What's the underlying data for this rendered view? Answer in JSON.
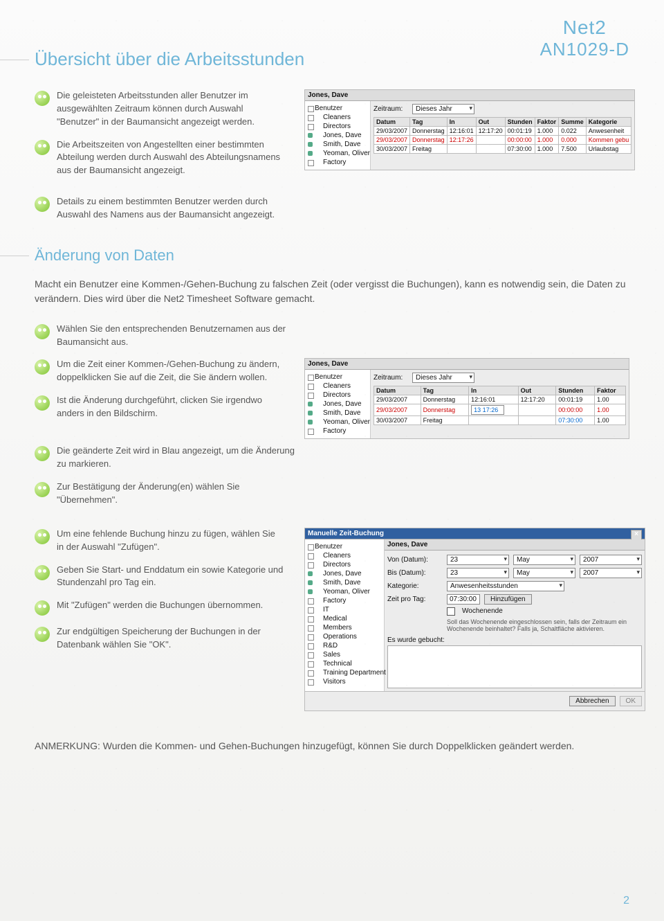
{
  "brand": {
    "line1": "Net2",
    "line2": "AN1029-D"
  },
  "page_title": "Übersicht über die Arbeitsstunden",
  "page_number": "2",
  "section1_bullets": [
    "Die geleisteten Arbeitsstunden aller Benutzer im ausgewählten Zeitraum können durch Auswahl \"Benutzer\" in der Baumansicht angezeigt werden.",
    "Die Arbeitszeiten von Angestellten einer bestimmten Abteilung werden durch Auswahl des Abteilungsnamens aus der Baumansicht angezeigt.",
    "Details zu einem bestimmten Benutzer werden durch Auswahl des Namens aus der Baumansicht angezeigt."
  ],
  "fig1": {
    "title": "Jones, Dave",
    "tree_root": "Benutzer",
    "tree_groups": [
      "Cleaners",
      "Directors"
    ],
    "tree_leaves": [
      "Jones, Dave",
      "Smith, Dave",
      "Yeoman, Oliver"
    ],
    "tree_last": "Factory",
    "period_label": "Zeitraum:",
    "period_value": "Dieses Jahr",
    "headers": [
      "Datum",
      "Tag",
      "In",
      "Out",
      "Stunden",
      "Faktor",
      "Summe",
      "Kategorie"
    ],
    "rows": [
      [
        "29/03/2007",
        "Donnerstag",
        "12:16:01",
        "12:17:20",
        "00:01:19",
        "1.000",
        "0.022",
        "Anwesenheit"
      ],
      [
        "29/03/2007",
        "Donnerstag",
        "12:17:26",
        "",
        "00:00:00",
        "1.000",
        "0.000",
        "Kommen gebu"
      ],
      [
        "30/03/2007",
        "Freitag",
        "",
        "",
        "07:30:00",
        "1.000",
        "7.500",
        "Urlaubstag"
      ]
    ]
  },
  "section2_title": "Änderung von Daten",
  "section2_intro": "Macht ein Benutzer eine Kommen-/Gehen-Buchung zu falschen Zeit (oder vergisst die Buchungen), kann es notwendig sein, die Daten zu verändern. Dies wird über die Net2 Timesheet Software gemacht.",
  "section2_bullets_a": [
    "Wählen Sie den entsprechenden Benutzernamen aus der Baumansicht aus."
  ],
  "section2_bullets_b": [
    "Um die Zeit einer Kommen-/Gehen-Buchung zu ändern, doppelklicken Sie auf die Zeit, die Sie ändern wollen.",
    "Ist die Änderung durchgeführt, clicken Sie irgendwo anders in den Bildschirm.",
    "Die geänderte Zeit wird in Blau angezeigt, um die Änderung zu markieren.",
    "Zur Bestätigung der Änderung(en) wählen Sie \"Übernehmen\"."
  ],
  "fig2": {
    "title": "Jones, Dave",
    "period_label": "Zeitraum:",
    "period_value": "Dieses Jahr",
    "headers": [
      "Datum",
      "Tag",
      "In",
      "Out",
      "Stunden",
      "Faktor"
    ],
    "rows": [
      [
        "29/03/2007",
        "Donnerstag",
        "12:16:01",
        "12:17:20",
        "00:01:19",
        "1.00"
      ],
      [
        "29/03/2007",
        "Donnerstag",
        "13 17:26",
        "",
        "00:00:00",
        "1.00"
      ],
      [
        "30/03/2007",
        "Freitag",
        "",
        "",
        "07:30:00",
        "1.00"
      ]
    ],
    "edit_cell": "13 17:26"
  },
  "section2_bullets_c": [
    "Um eine fehlende Buchung hinzu zu fügen, wählen Sie in der Auswahl \"Zufügen\".",
    "Geben Sie Start- und Enddatum ein sowie Kategorie und Stundenzahl pro Tag ein.",
    "Mit \"Zufügen\" werden die Buchungen übernommen.",
    "Zur endgültigen Speicherung der Buchungen in der Datenbank wählen Sie \"OK\"."
  ],
  "fig3": {
    "dialog_title": "Manuelle Zeit-Buchung",
    "user_title": "Jones, Dave",
    "tree_root": "Benutzer",
    "tree_groups": [
      "Cleaners",
      "Directors"
    ],
    "tree_leaves": [
      "Jones, Dave",
      "Smith, Dave",
      "Yeoman, Oliver"
    ],
    "tree_more": [
      "Factory",
      "IT",
      "Medical",
      "Members",
      "Operations",
      "R&D",
      "Sales",
      "Technical",
      "Training Department",
      "Visitors"
    ],
    "labels": {
      "from": "Von (Datum):",
      "to": "Bis (Datum):",
      "category": "Kategorie:",
      "time_per_day": "Zeit pro Tag:",
      "weekend": "Wochenende",
      "weekend_hint": "Soll das Wochenende eingeschlossen sein, falls der Zeitraum ein Wochenende beinhaltet? Falls ja, Schaltfläche aktivieren.",
      "booked": "Es wurde gebucht:"
    },
    "values": {
      "from_day": "23",
      "from_month": "May",
      "from_year": "2007",
      "to_day": "23",
      "to_month": "May",
      "to_year": "2007",
      "category": "Anwesenheitsstunden",
      "time": "07:30:00"
    },
    "buttons": {
      "add": "Hinzufügen",
      "cancel": "Abbrechen",
      "ok": "OK"
    }
  },
  "final_note": "ANMERKUNG: Wurden die Kommen- und Gehen-Buchungen hinzugefügt, können Sie durch Doppelklicken geändert werden."
}
